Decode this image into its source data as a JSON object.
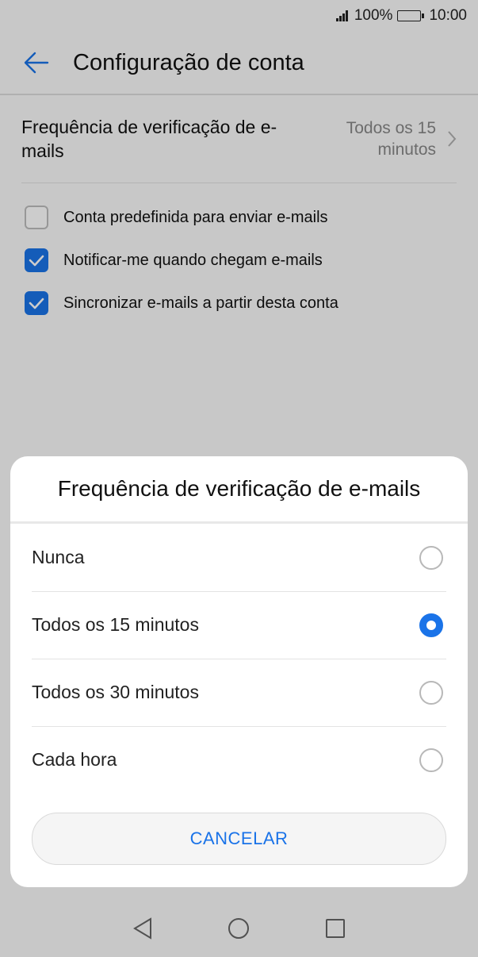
{
  "status_bar": {
    "battery": "100%",
    "time": "10:00"
  },
  "header": {
    "title": "Configuração de conta"
  },
  "check_frequency": {
    "label": "Frequência de verificação de e-mails",
    "value": "Todos os 15 minutos"
  },
  "checkboxes": [
    {
      "label": "Conta predefinida para enviar e-mails",
      "checked": false
    },
    {
      "label": "Notificar-me quando chegam e-mails",
      "checked": true
    },
    {
      "label": "Sincronizar e-mails a partir desta conta",
      "checked": true
    }
  ],
  "dialog": {
    "title": "Frequência de verificação de e-mails",
    "options": [
      {
        "label": "Nunca",
        "selected": false
      },
      {
        "label": "Todos os 15 minutos",
        "selected": true
      },
      {
        "label": "Todos os 30 minutos",
        "selected": false
      },
      {
        "label": "Cada hora",
        "selected": false
      }
    ],
    "cancel_label": "CANCELAR"
  },
  "colors": {
    "accent": "#1a73e8",
    "scrim": "rgba(0,0,0,0.2)"
  },
  "icons": [
    "signal-icon",
    "battery-icon",
    "back-arrow-icon",
    "chevron-right-icon",
    "check-icon",
    "nav-back-icon",
    "nav-home-icon",
    "nav-recents-icon"
  ]
}
